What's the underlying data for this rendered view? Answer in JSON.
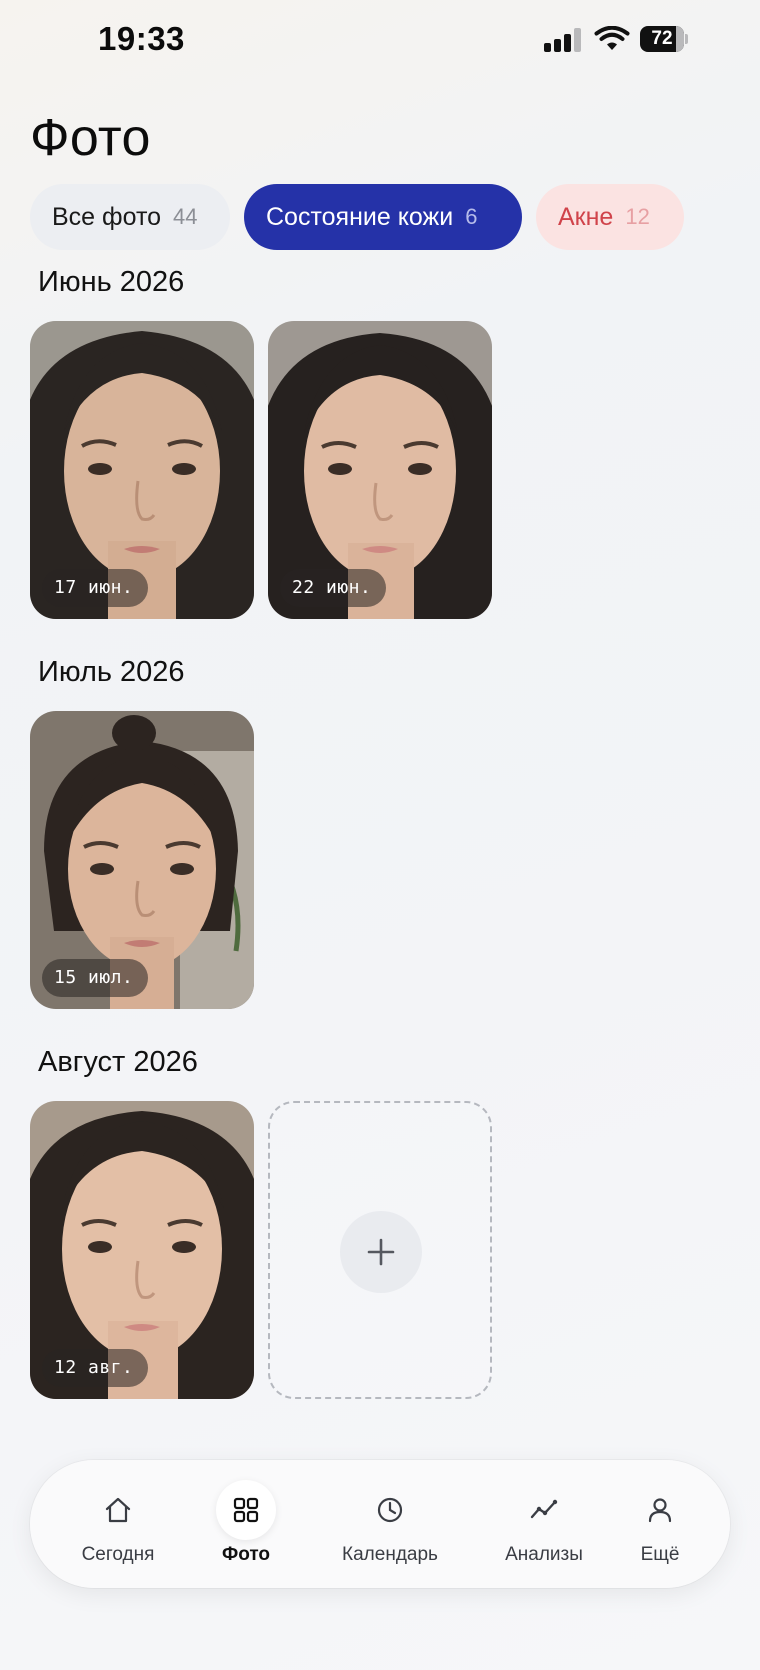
{
  "status_bar": {
    "time": "19:33",
    "battery": "72"
  },
  "page_title": "Фото",
  "filters": [
    {
      "label": "Все фото",
      "count": "44"
    },
    {
      "label": "Состояние кожи",
      "count": "6"
    },
    {
      "label": "Акне",
      "count": "12"
    }
  ],
  "sections": [
    {
      "title": "Июнь 2026",
      "photos": [
        {
          "date": "17 июн."
        },
        {
          "date": "22 июн."
        }
      ]
    },
    {
      "title": "Июль 2026",
      "photos": [
        {
          "date": "15 июл."
        }
      ]
    },
    {
      "title": "Август 2026",
      "photos": [
        {
          "date": "12 авг."
        }
      ]
    }
  ],
  "nav": [
    {
      "label": "Сегодня",
      "icon": "home-icon"
    },
    {
      "label": "Фото",
      "icon": "grid-icon"
    },
    {
      "label": "Календарь",
      "icon": "clock-icon"
    },
    {
      "label": "Анализы",
      "icon": "trend-icon"
    },
    {
      "label": "Ещё",
      "icon": "profile-icon"
    }
  ],
  "colors": {
    "accent": "#2532a8",
    "acne_text": "#d0434a",
    "acne_bg": "#fbe3e2",
    "chip_bg": "#eceef2"
  }
}
